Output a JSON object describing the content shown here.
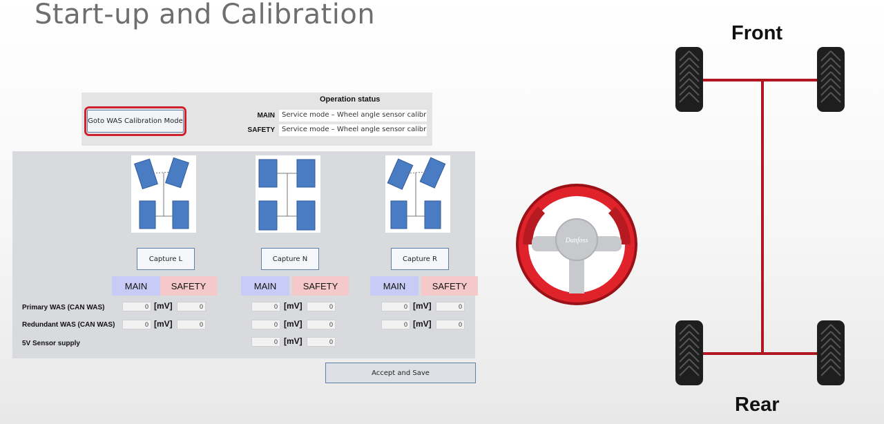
{
  "title": "Start-up and Calibration",
  "status_panel": {
    "goto_button": "Goto WAS Calibration Mode",
    "heading": "Operation status",
    "rows": [
      {
        "label": "MAIN",
        "value": "Service mode – Wheel angle sensor calibration"
      },
      {
        "label": "SAFETY",
        "value": "Service mode – Wheel angle sensor calibration"
      }
    ]
  },
  "calibration": {
    "columns": [
      {
        "capture_label": "Capture L",
        "wheel_pose": "left"
      },
      {
        "capture_label": "Capture N",
        "wheel_pose": "neutral"
      },
      {
        "capture_label": "Capture R",
        "wheel_pose": "right"
      }
    ],
    "main_header": "MAIN",
    "safety_header": "SAFETY",
    "unit": "[mV]",
    "row_labels": [
      "Primary WAS (CAN WAS)",
      "Redundant WAS (CAN WAS)",
      "5V Sensor supply"
    ],
    "values": {
      "primary": [
        [
          "0",
          "0"
        ],
        [
          "0",
          "0"
        ],
        [
          "0",
          "0"
        ]
      ],
      "redundant": [
        [
          "0",
          "0"
        ],
        [
          "0",
          "0"
        ],
        [
          "0",
          "0"
        ]
      ],
      "supply": [
        "0",
        "0"
      ]
    },
    "accept_button": "Accept and Save"
  },
  "diagram": {
    "front_label": "Front",
    "rear_label": "Rear",
    "logo_text": "Danfoss"
  },
  "colors": {
    "highlight_red": "#d0212e",
    "main_header_bg": "#c8cbf5",
    "safety_header_bg": "#f5c9c9",
    "car_blue": "#4a7cc4",
    "chassis_red": "#b01722",
    "wheel_red": "#e0222b"
  }
}
